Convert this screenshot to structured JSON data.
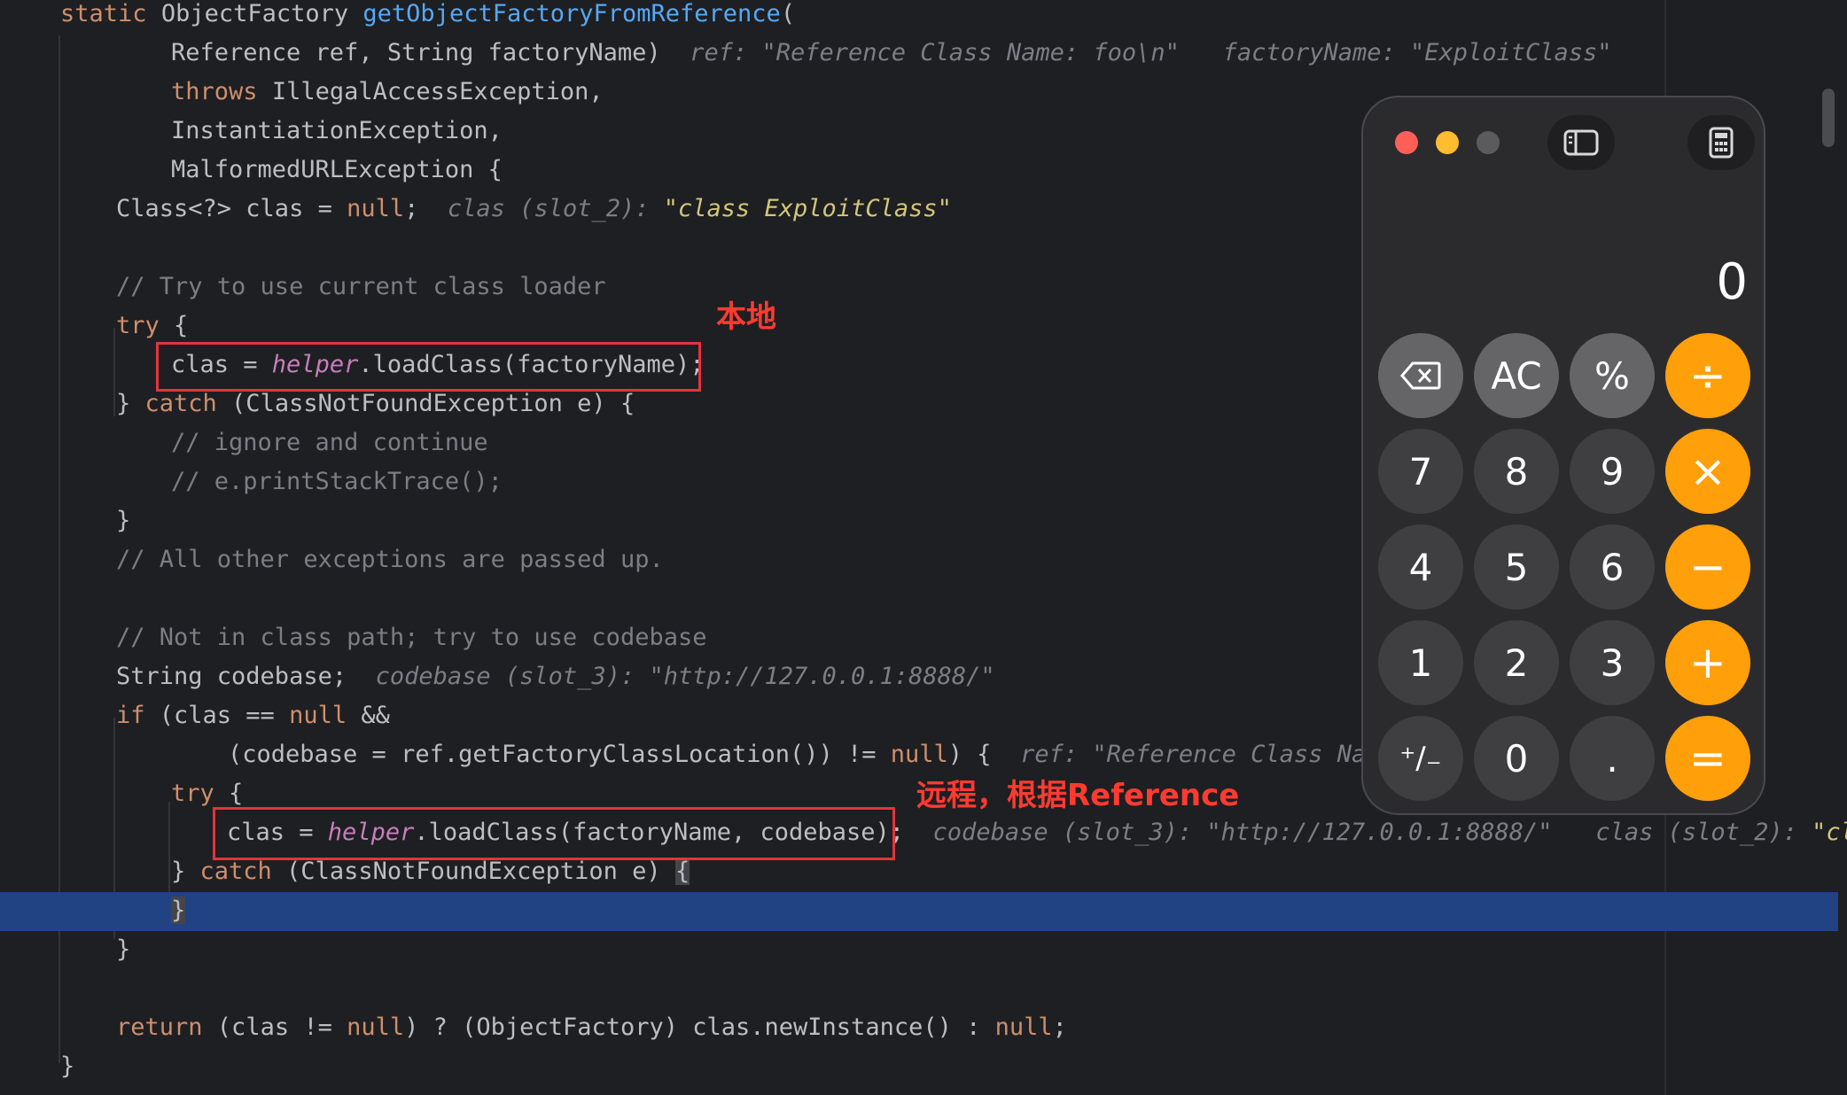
{
  "code": {
    "l1_kw": "static",
    "l1_type": "ObjectFactory",
    "l1_fn": "getObjectFactoryFromReference",
    "l1_paren": "(",
    "l2_code": "Reference ref, String factoryName)",
    "l2_hint1": "ref: \"Reference Class Name: foo\\n\"",
    "l2_hint2": "factoryName: \"ExploitClass\"",
    "l3_kw": "throws",
    "l3_code": "IllegalAccessException,",
    "l4_code": "InstantiationException,",
    "l5_code": "MalformedURLException {",
    "l6_a": "Class<?> clas = ",
    "l6_null": "null",
    "l6_semi": ";",
    "l6_hint": "clas (slot_2): ",
    "l6_hintval": "\"class ExploitClass\"",
    "l8_comment": "// Try to use current class loader",
    "l9_kw": "try",
    "l9_brace": " {",
    "l10_a": "clas = ",
    "l10_field": "helper",
    "l10_b": ".loadClass(factoryName);",
    "l11_a": "} ",
    "l11_kw": "catch",
    "l11_b": " (ClassNotFoundException e) {",
    "l12_comment": "// ignore and continue",
    "l13_comment": "// e.printStackTrace();",
    "l14_code": "}",
    "l15_comment": "// All other exceptions are passed up.",
    "l17_comment": "// Not in class path; try to use codebase",
    "l18_code": "String codebase;",
    "l18_hint": "codebase (slot_3): \"http://127.0.0.1:8888/\"",
    "l19_kw": "if",
    "l19_a": " (clas == ",
    "l19_null": "null",
    "l19_b": " &&",
    "l20_a": "(codebase = ref.getFactoryClassLocation()) != ",
    "l20_null": "null",
    "l20_b": ") {",
    "l20_hint": "ref: \"Reference Class Name:",
    "l21_kw": "try",
    "l21_brace": " {",
    "l22_a": "clas = ",
    "l22_field": "helper",
    "l22_b": ".loadClass(factoryName, codebase);",
    "l22_hint1": "codebase (slot_3): \"http://127.0.0.1:8888/\"",
    "l22_hint2": "clas (slot_2): ",
    "l22_hint2val": "\"clas",
    "l23_a": "} ",
    "l23_kw": "catch",
    "l23_b": " (ClassNotFoundException e) ",
    "l23_brace": "{",
    "l24_brace": "}",
    "l25_code": "}",
    "l27_kw": "return",
    "l27_a": " (clas != ",
    "l27_null1": "null",
    "l27_b": ") ? (ObjectFactory) clas.newInstance() : ",
    "l27_null2": "null",
    "l27_semi": ";",
    "l28_code": "}"
  },
  "annotations": {
    "local": "本地",
    "remote": "远程，根据Reference"
  },
  "calculator": {
    "display": "0",
    "keys": [
      "⌫",
      "AC",
      "%",
      "÷",
      "7",
      "8",
      "9",
      "×",
      "4",
      "5",
      "6",
      "−",
      "1",
      "2",
      "3",
      "+",
      "⁺∕₋",
      "0",
      ".",
      "="
    ],
    "colors": {
      "operator": "#ff9f0a",
      "function": "#656568",
      "number": "#3f3f42",
      "close": "#ff5f57",
      "minimize": "#febc2e",
      "zoom": "#5b5b5e"
    }
  }
}
